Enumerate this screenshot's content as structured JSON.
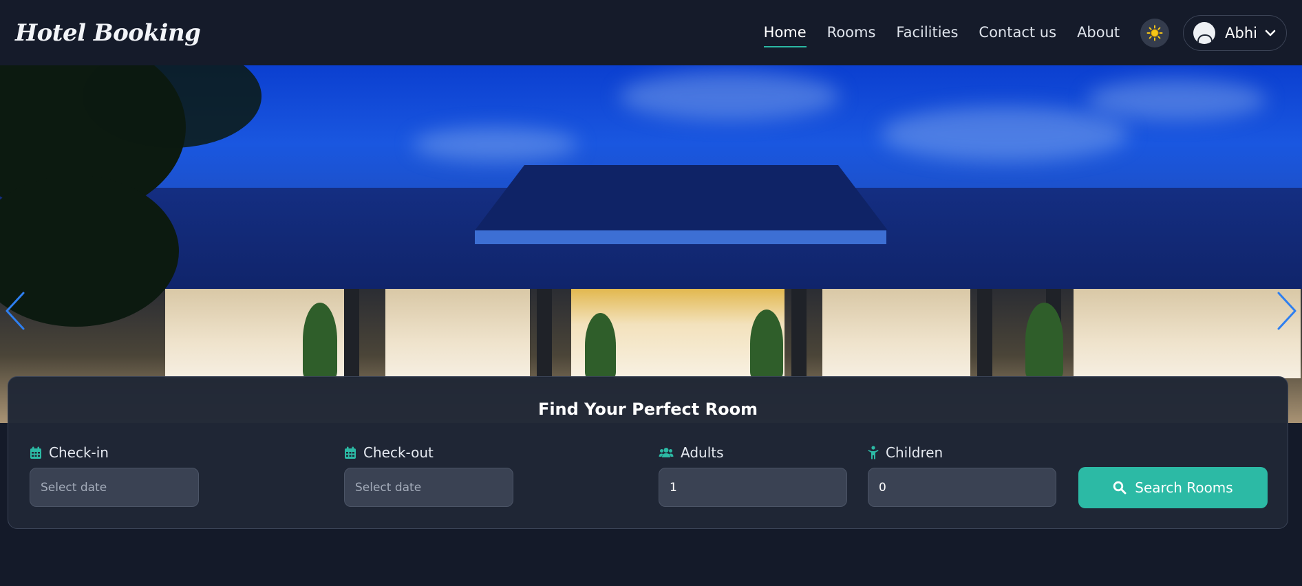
{
  "brand": "Hotel Booking",
  "nav": {
    "links": [
      "Home",
      "Rooms",
      "Facilities",
      "Contact us",
      "About"
    ],
    "active": "Home"
  },
  "user": {
    "name": "Abhi"
  },
  "icons": {
    "theme": "sun-icon",
    "user_menu": "chevron-down-icon",
    "prev": "chevron-left-icon",
    "next": "chevron-right-icon",
    "checkin": "calendar-icon",
    "checkout": "calendar-icon",
    "adults": "users-icon",
    "children": "child-icon",
    "search": "search-icon"
  },
  "colors": {
    "accent": "#2cbaa5",
    "sun": "#f5c518",
    "background": "#141a29",
    "carousel_arrow": "#2e7ff0"
  },
  "search": {
    "title": "Find Your Perfect Room",
    "checkin": {
      "label": "Check-in",
      "placeholder": "Select date"
    },
    "checkout": {
      "label": "Check-out",
      "placeholder": "Select date"
    },
    "adults": {
      "label": "Adults",
      "value": "1"
    },
    "children": {
      "label": "Children",
      "value": "0"
    },
    "button": "Search Rooms"
  }
}
